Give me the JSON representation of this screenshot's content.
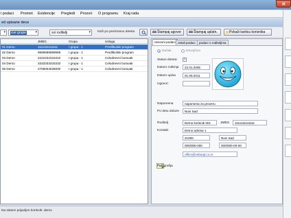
{
  "menu": [
    "i podaci",
    "Promet",
    "Evidencije",
    "Pregledi",
    "Prozori",
    "O programu",
    "Kraj rada"
  ],
  "form_title": "ed upisane dece",
  "toolbar": {
    "combo1_value": "",
    "combo2_value": "sve grupe",
    "combo3_value": "svi roditelji",
    "search_label": "traži po prezimenu deteta",
    "print_contract": "Štampaj ugovor",
    "print_receipt": "Štampaj uplatn.",
    "card_label": "Pokaži karticu korisnika"
  },
  "grid": {
    "headers": [
      "",
      "JMBG",
      "Grupa",
      "Usluga"
    ],
    "rows": [
      {
        "name": "01 Demo",
        "jmbg": "1111111111111",
        "group": "I grupa - 1",
        "service": "Predškolski program",
        "selected": true
      },
      {
        "name": "02 Demo",
        "jmbg": "9999999999999",
        "group": "I grupa - 1",
        "service": "Predškolski program",
        "selected": false
      },
      {
        "name": "03 Demo",
        "jmbg": "2222222222222",
        "group": "I grupa - 1",
        "service": "Celodnevni boravak",
        "selected": false
      },
      {
        "name": "04 Demo",
        "jmbg": "3333333333333",
        "group": "I grupa - 1",
        "service": "Celodnevni boravak",
        "selected": false
      },
      {
        "name": "05 Demo",
        "jmbg": "2706004025000",
        "group": "I grupa - 1",
        "service": "Celodnevni boravak",
        "selected": false
      }
    ]
  },
  "tabs": [
    "osnovni podaci",
    "ostali podaci",
    "podaci o roditeljima"
  ],
  "details": {
    "gender_male": "Dečak",
    "gender_female": "Devojčica",
    "status_label": "Status deteta:",
    "status_check": "✓",
    "birth_label": "Datum rođenja",
    "birth_value": "22.01.2005",
    "enroll_label": "Datum upisa",
    "enroll_value": "01.09.2011",
    "contract_label": "Ugovor:",
    "note_label": "Napomena",
    "note_value": "napomena za proveru",
    "born_label": "Po detu dolaze",
    "born_value": "Novi Sad",
    "parent_label": "Roditelj",
    "parent_value": "Demo korisnik 001",
    "jmbg_label": "JMBG",
    "parent_jmbg": "1111111111111",
    "contact_label": "Kontakt",
    "address": "Demo adresa 1",
    "zip": "21000",
    "city": "Novi Sad",
    "phone1": "000/000-000",
    "phone2": "000/000-00-00",
    "email": "office@vebsajt.co.rs",
    "photo_label": "Fotografija"
  },
  "status_text": "Na sistem prijavljen korisnik: demo",
  "icons": [
    "close-icon",
    "print-icon",
    "smiley-icon",
    "envelope-icon",
    "search-icon"
  ]
}
